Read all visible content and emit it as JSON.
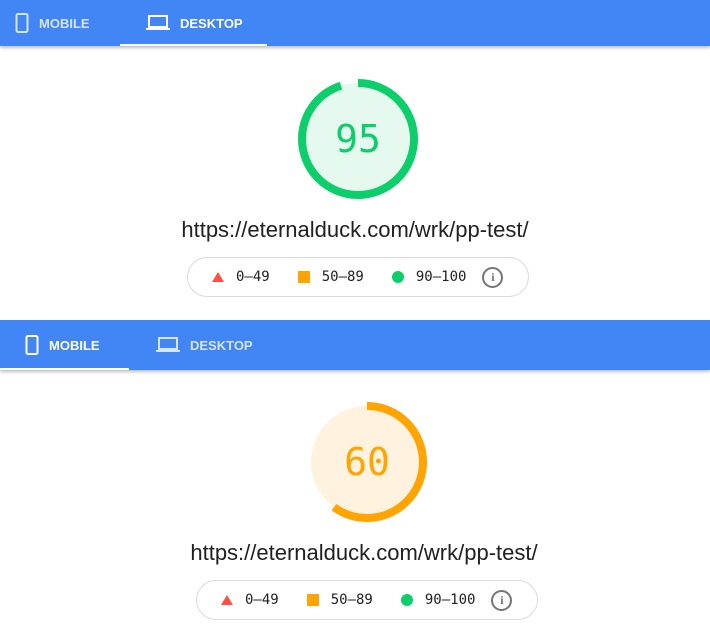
{
  "colors": {
    "header": "#4285f4",
    "pass": "#0cce6b",
    "pass_bg": "#e6f9ef",
    "average": "#ffa400",
    "average_bg": "#fff3e0",
    "fail": "#ff4e42"
  },
  "panels": [
    {
      "tabs": [
        {
          "label": "MOBILE",
          "icon": "phone-icon",
          "active": false
        },
        {
          "label": "DESKTOP",
          "icon": "laptop-icon",
          "active": true
        }
      ],
      "score": 95,
      "score_label": "95",
      "url": "https://eternalduck.com/wrk/pp-test/"
    },
    {
      "tabs": [
        {
          "label": "MOBILE",
          "icon": "phone-icon",
          "active": true
        },
        {
          "label": "DESKTOP",
          "icon": "laptop-icon",
          "active": false
        }
      ],
      "score": 60,
      "score_label": "60",
      "url": "https://eternalduck.com/wrk/pp-test/"
    }
  ],
  "legend": {
    "fail": "0–49",
    "average": "50–89",
    "pass": "90–100",
    "info_icon": "info-icon"
  }
}
